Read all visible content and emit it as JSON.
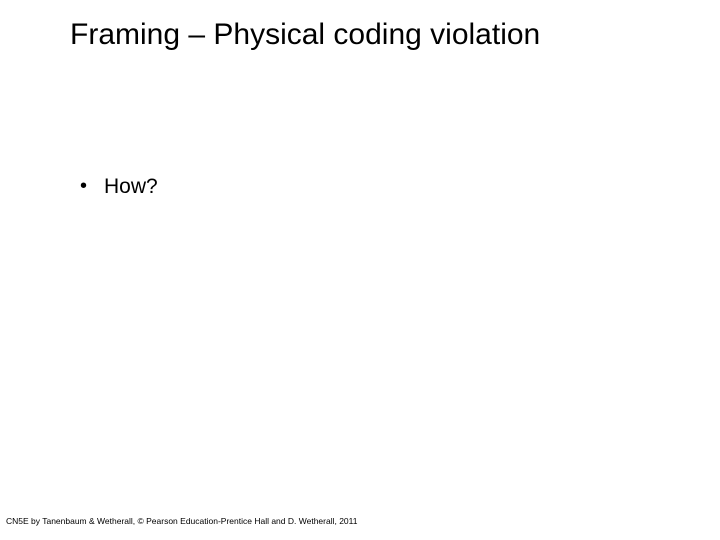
{
  "title": "Framing – Physical coding violation",
  "bullets": [
    "How?"
  ],
  "footer": "CN5E by Tanenbaum & Wetherall, © Pearson Education-Prentice Hall and D. Wetherall, 2011"
}
